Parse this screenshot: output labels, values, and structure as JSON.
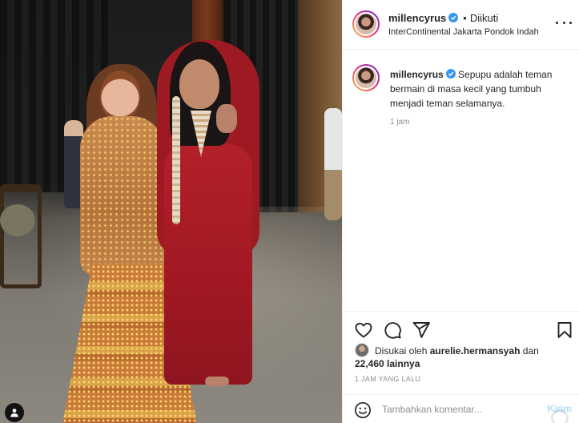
{
  "post": {
    "author": "millencyrus",
    "follow_separator": "•",
    "follow_status": "Diikuti",
    "location": "InterContinental Jakarta Pondok Indah",
    "more_icon": "more-horizontal-icon"
  },
  "caption": {
    "username": "millencyrus",
    "text": "Sepupu adalah teman bermain di masa kecil yang tumbuh menjadi teman selamanya.",
    "time": "1 jam"
  },
  "actions": {
    "like_icon": "heart-icon",
    "comment_icon": "comment-icon",
    "share_icon": "share-icon",
    "save_icon": "bookmark-icon"
  },
  "likes": {
    "prefix": "Disukai oleh",
    "user": "aurelie.hermansyah",
    "middle": "dan",
    "count": "22,460",
    "suffix": "lainnya"
  },
  "date": "1 JAM YANG LALU",
  "comment": {
    "placeholder": "Tambahkan komentar...",
    "post_label": "Kirim"
  },
  "colors": {
    "accent": "#0095f6",
    "post_disabled": "#b2dffc",
    "muted_text": "#8e8e8e",
    "verified": "#3897f0"
  }
}
